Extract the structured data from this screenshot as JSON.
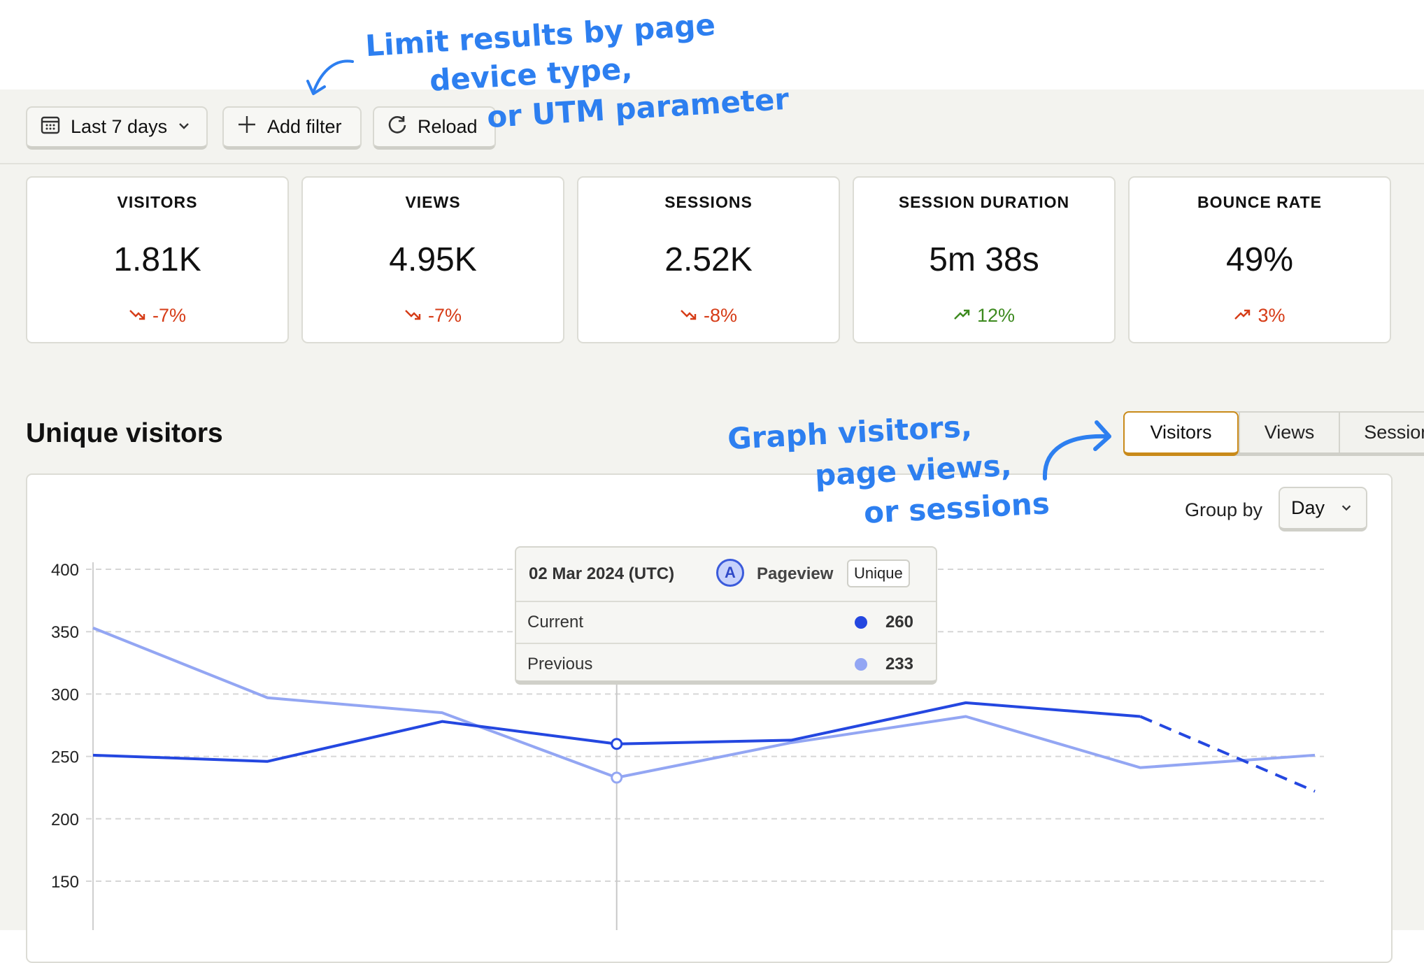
{
  "toolbar": {
    "date_range": "Last 7 days",
    "add_filter": "Add filter",
    "reload": "Reload"
  },
  "stats": [
    {
      "label": "VISITORS",
      "value": "1.81K",
      "change": "-7%",
      "trend": "down"
    },
    {
      "label": "VIEWS",
      "value": "4.95K",
      "change": "-7%",
      "trend": "down"
    },
    {
      "label": "SESSIONS",
      "value": "2.52K",
      "change": "-8%",
      "trend": "down"
    },
    {
      "label": "SESSION DURATION",
      "value": "5m 38s",
      "change": "12%",
      "trend": "up-good"
    },
    {
      "label": "BOUNCE RATE",
      "value": "49%",
      "change": "3%",
      "trend": "up-bad"
    }
  ],
  "section": {
    "title": "Unique visitors"
  },
  "metric_tabs": [
    {
      "label": "Visitors",
      "active": true
    },
    {
      "label": "Views",
      "active": false
    },
    {
      "label": "Sessions",
      "active": false
    }
  ],
  "group_by": {
    "label": "Group by",
    "value": "Day"
  },
  "tooltip": {
    "date": "02 Mar 2024 (UTC)",
    "badge": "A",
    "event": "Pageview",
    "mode": "Unique",
    "rows": [
      {
        "label": "Current",
        "value": "260",
        "color": "#2447e0"
      },
      {
        "label": "Previous",
        "value": "233",
        "color": "#93a6f3"
      }
    ]
  },
  "annotations": {
    "filter_line1": "Limit results by page",
    "filter_line2": "device type,",
    "filter_line3": "or UTM parameter",
    "graph_line1": "Graph visitors,",
    "graph_line2": "page views,",
    "graph_line3": "or sessions"
  },
  "colors": {
    "current": "#2447e0",
    "previous": "#93a6f3",
    "annotation": "#2d7ff0",
    "decrease": "#d63c17",
    "increase": "#3d8a1f",
    "active_tab": "#c98a1a"
  },
  "chart_data": {
    "type": "line",
    "yticks": [
      150,
      200,
      250,
      300,
      350,
      400
    ],
    "ylim": [
      100,
      400
    ],
    "grid": true,
    "highlight_index": 3,
    "forecast_from_index": 6,
    "series": [
      {
        "values": [
          251,
          246,
          278,
          260,
          263,
          293,
          282,
          222
        ]
      },
      {
        "values": [
          353,
          297,
          285,
          233,
          261,
          282,
          241,
          251
        ]
      }
    ]
  }
}
